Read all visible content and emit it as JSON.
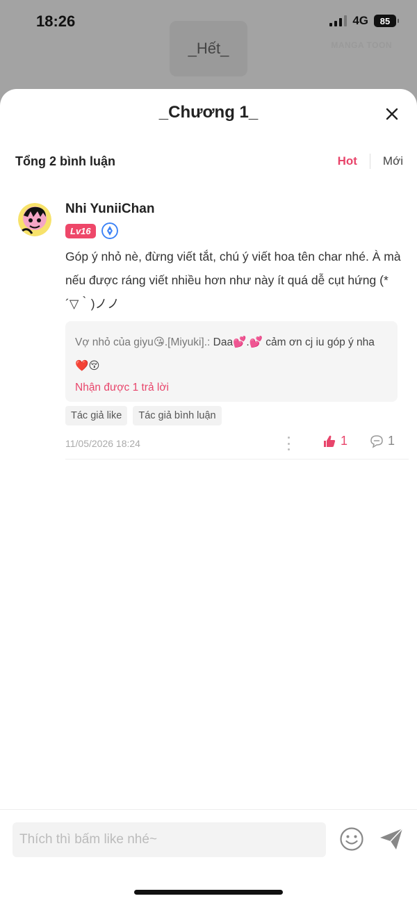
{
  "status_bar": {
    "time": "18:26",
    "network": "4G",
    "battery": "85"
  },
  "background": {
    "end_label": "_Hết_",
    "watermark": "MANGA TOON"
  },
  "sheet": {
    "title": "_Chương 1_",
    "close_icon": "close-icon"
  },
  "comments_header": {
    "count_label": "Tổng 2 bình luận",
    "sort_tabs": [
      {
        "label": "Hot",
        "active": true
      },
      {
        "label": "Mới",
        "active": false
      }
    ]
  },
  "comment": {
    "username": "Nhi YuniiChan",
    "level_badge": "Lv16",
    "role_icon": "pen-nib-badge-icon",
    "text": "Góp ý nhỏ nè, đừng viết tắt, chú ý viết hoa tên char nhé. À mà nếu được ráng viết nhiều hơn như này ít quá dễ cụt hứng (*´▽｀)ノノ",
    "reply": {
      "author": "Vợ nhỏ của giyu😘.[Miyuki].:",
      "text": " Daa💕.💕 cảm ơn cj iu góp ý nha❤️😚",
      "more_label": "Nhận được 1 trả lời"
    },
    "tags": [
      "Tác giả like",
      "Tác giả bình luận"
    ],
    "timestamp": "11/05/2026 18:24",
    "like_count": "1",
    "reply_count": "1"
  },
  "composer": {
    "placeholder": "Thích thì bấm like nhé~",
    "emoji_icon": "smiley-icon",
    "send_icon": "send-icon"
  },
  "colors": {
    "accent": "#e8456b",
    "level_badge": "#ee4769",
    "role_badge": "#3b82f6"
  }
}
